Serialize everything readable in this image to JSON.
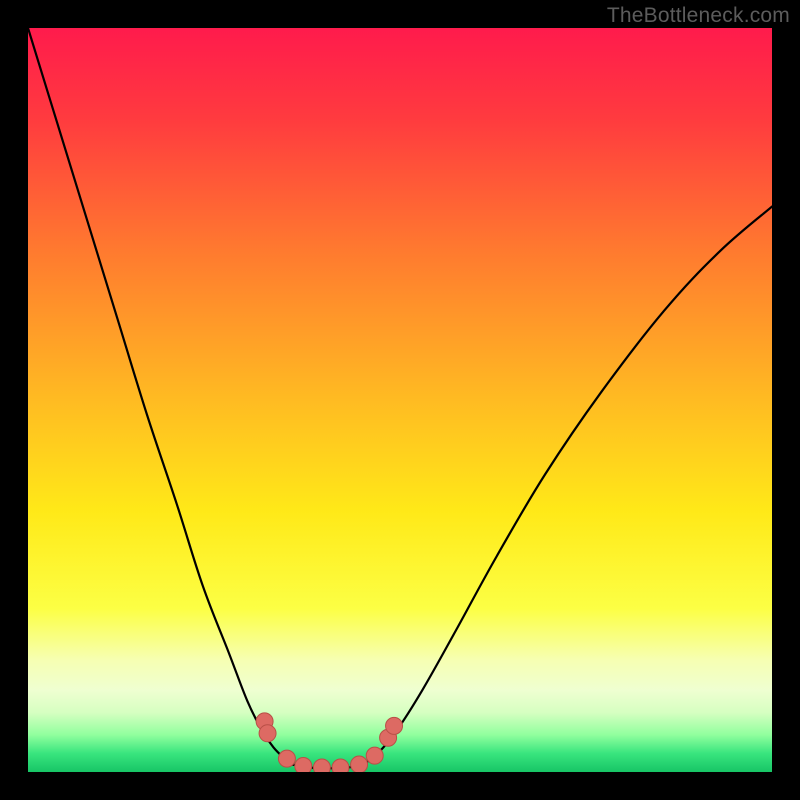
{
  "watermark": "TheBottleneck.com",
  "chart_data": {
    "type": "line",
    "title": "",
    "xlabel": "",
    "ylabel": "",
    "xlim": [
      0,
      1
    ],
    "ylim": [
      0,
      1
    ],
    "gradient_stops": [
      {
        "offset": 0.0,
        "color": "#ff1b4c"
      },
      {
        "offset": 0.12,
        "color": "#ff3a3f"
      },
      {
        "offset": 0.3,
        "color": "#ff7a2f"
      },
      {
        "offset": 0.5,
        "color": "#ffbb22"
      },
      {
        "offset": 0.65,
        "color": "#ffe918"
      },
      {
        "offset": 0.78,
        "color": "#fcff44"
      },
      {
        "offset": 0.85,
        "color": "#f6ffb3"
      },
      {
        "offset": 0.89,
        "color": "#efffd1"
      },
      {
        "offset": 0.92,
        "color": "#d6ffc1"
      },
      {
        "offset": 0.95,
        "color": "#91ff9e"
      },
      {
        "offset": 0.975,
        "color": "#39e57e"
      },
      {
        "offset": 1.0,
        "color": "#17c566"
      }
    ],
    "series": [
      {
        "name": "left_branch",
        "x": [
          0.0,
          0.04,
          0.08,
          0.12,
          0.16,
          0.2,
          0.235,
          0.27,
          0.295,
          0.315,
          0.33,
          0.345,
          0.356
        ],
        "y": [
          1.0,
          0.87,
          0.74,
          0.61,
          0.48,
          0.36,
          0.25,
          0.16,
          0.095,
          0.055,
          0.033,
          0.018,
          0.01
        ]
      },
      {
        "name": "bottom_flat",
        "x": [
          0.356,
          0.38,
          0.405,
          0.43,
          0.45
        ],
        "y": [
          0.01,
          0.006,
          0.005,
          0.006,
          0.01
        ]
      },
      {
        "name": "right_branch",
        "x": [
          0.45,
          0.47,
          0.495,
          0.53,
          0.575,
          0.63,
          0.695,
          0.77,
          0.855,
          0.93,
          1.0
        ],
        "y": [
          0.01,
          0.025,
          0.055,
          0.11,
          0.19,
          0.29,
          0.4,
          0.51,
          0.62,
          0.7,
          0.76
        ]
      }
    ],
    "markers": {
      "color": "#dd6a63",
      "stroke": "#b94f47",
      "points": [
        {
          "x": 0.318,
          "y": 0.068
        },
        {
          "x": 0.322,
          "y": 0.052
        },
        {
          "x": 0.348,
          "y": 0.018
        },
        {
          "x": 0.37,
          "y": 0.008
        },
        {
          "x": 0.395,
          "y": 0.006
        },
        {
          "x": 0.42,
          "y": 0.006
        },
        {
          "x": 0.445,
          "y": 0.01
        },
        {
          "x": 0.466,
          "y": 0.022
        },
        {
          "x": 0.484,
          "y": 0.046
        },
        {
          "x": 0.492,
          "y": 0.062
        }
      ]
    }
  }
}
